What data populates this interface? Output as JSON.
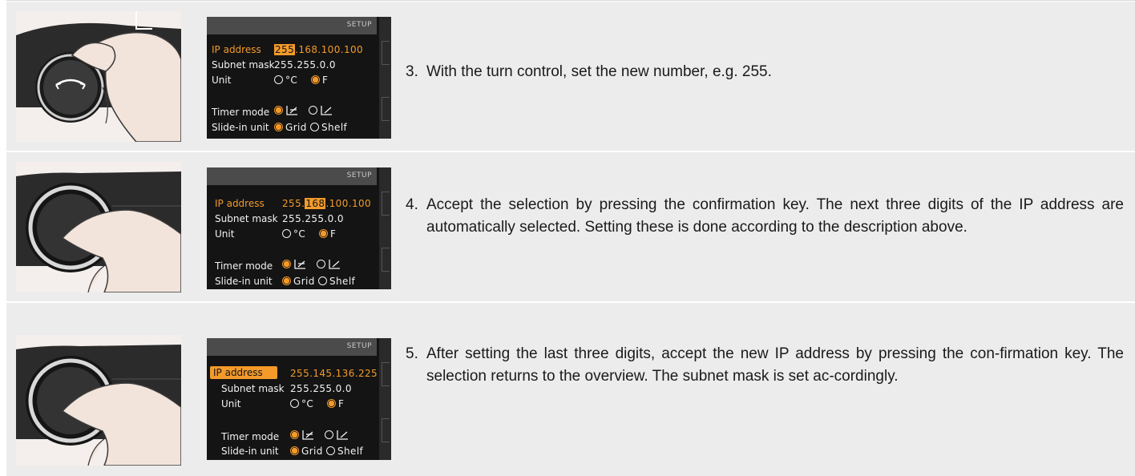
{
  "steps": [
    {
      "number": "3.",
      "text": "With the turn control, set the new number, e.g. 255.",
      "illustration": "turn-control-icon",
      "screen": {
        "header": "SETUP",
        "ip_label": "IP address",
        "ip_selected": "255",
        "ip_rest": ".168.100.100",
        "subnet_label": "Subnet mask",
        "subnet_value": "255.255.0.0",
        "unit_label": "Unit",
        "unit_c": "°C",
        "unit_f": "F",
        "timer_label": "Timer mode",
        "slide_label": "Slide-in unit",
        "grid": "Grid",
        "shelf": "Shelf"
      }
    },
    {
      "number": "4.",
      "text": "Accept the selection by pressing the confirmation key. The next three digits of the IP address are automatically selected. Setting these is done according to the description above.",
      "illustration": "confirmation-key-icon",
      "screen": {
        "header": "SETUP",
        "ip_label": "IP address",
        "ip_before": "255.",
        "ip_selected": "168",
        "ip_rest": ".100.100",
        "subnet_label": "Subnet mask",
        "subnet_value": "255.255.0.0",
        "unit_label": "Unit",
        "unit_c": "°C",
        "unit_f": "F",
        "timer_label": "Timer mode",
        "slide_label": "Slide-in unit",
        "grid": "Grid",
        "shelf": "Shelf"
      }
    },
    {
      "number": "5.",
      "text": "After setting the last three digits, accept the new IP address by pressing the con-firmation key. The selection returns to the overview. The subnet mask is set ac-cordingly.",
      "illustration": "confirmation-key-icon",
      "screen": {
        "header": "SETUP",
        "ip_label": "IP address",
        "ip_value": "255.145.136.225",
        "subnet_label": "Subnet mask",
        "subnet_value": "255.255.0.0",
        "unit_label": "Unit",
        "unit_c": "°C",
        "unit_f": "F",
        "timer_label": "Timer mode",
        "slide_label": "Slide-in unit",
        "grid": "Grid",
        "shelf": "Shelf"
      }
    }
  ],
  "colors": {
    "accent": "#f39a2a",
    "row_bg": "#ececec",
    "screen_bg": "#141414"
  }
}
